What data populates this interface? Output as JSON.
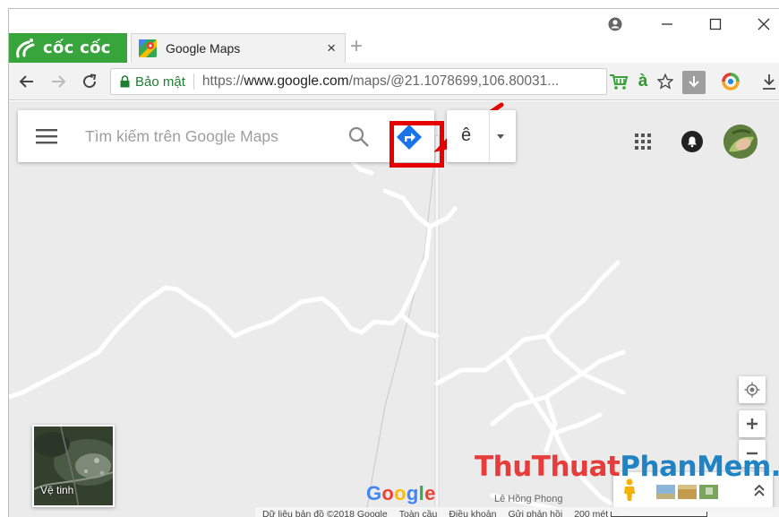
{
  "browser": {
    "brand_name": "cốc cốc",
    "tab_title": "Google Maps",
    "tab_close": "×",
    "new_tab": "+",
    "secure_label": "Bảo mật",
    "url_prefix": "https://",
    "url_host": "www.google.com",
    "url_path": "/maps/@21.1078699,106.80031...",
    "ext_letter": "à"
  },
  "maps": {
    "search_placeholder": "Tìm kiếm trên Google Maps",
    "language_label": "ê",
    "satellite_label": "Vệ tinh",
    "google_logo": [
      "G",
      "o",
      "o",
      "g",
      "l",
      "e"
    ],
    "street_label": "Lê Hồng Phong",
    "footer": {
      "copyright": "Dữ liệu bản đồ ©2018 Google",
      "terms_all": "Toàn cầu",
      "terms": "Điều khoản",
      "feedback": "Gửi phản hồi",
      "scale": "200 mét"
    }
  },
  "watermark": [
    "Thu",
    "Thuat",
    "Phan",
    "Mem",
    ".vn"
  ],
  "colors": {
    "brand_green": "#38a43c",
    "highlight_red": "#e60000",
    "directions_blue": "#1a73e8",
    "map_bg": "#ebebeb"
  }
}
